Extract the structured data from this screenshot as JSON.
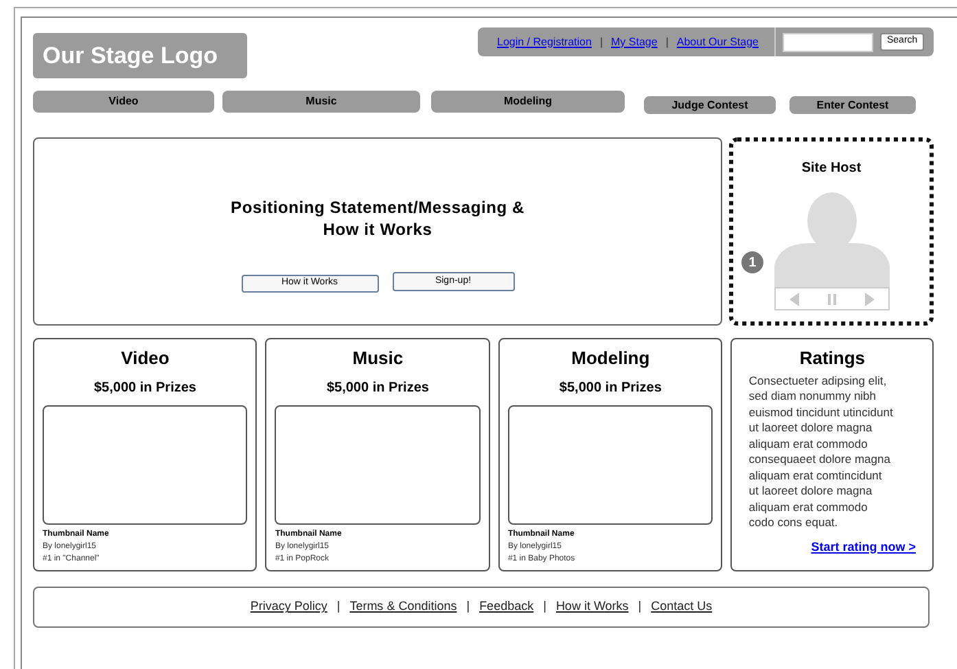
{
  "logo": {
    "text": "Our Stage Logo"
  },
  "top_links": [
    {
      "kind": "link",
      "text": "Login / Registration"
    },
    {
      "kind": "separator",
      "text": "|"
    },
    {
      "kind": "link",
      "text": "My Stage"
    },
    {
      "kind": "separator",
      "text": "|"
    },
    {
      "kind": "link",
      "text": "About Our Stage"
    }
  ],
  "search": {
    "button": "Search"
  },
  "nav": [
    {
      "label": "Video",
      "kind": "tab"
    },
    {
      "label": "Music",
      "kind": "tab"
    },
    {
      "label": "Modeling",
      "kind": "tab"
    },
    {
      "label": "Judge Contest",
      "kind": "action"
    },
    {
      "label": "Enter Contest",
      "kind": "action"
    }
  ],
  "hero": {
    "heading_lines": [
      "Positioning Statement/Messaging &",
      "How it Works"
    ],
    "buttons": [
      "How it Works",
      "Sign-up!"
    ]
  },
  "site_host": {
    "title": "Site Host",
    "badge": "1"
  },
  "categories": [
    {
      "title": "Video",
      "prize": "$5,000 in Prizes",
      "thumb_name": "Thumbnail Name",
      "by": "By lonelygirl15",
      "rank": "#1 in \"Channel\""
    },
    {
      "title": "Music",
      "prize": "$5,000 in Prizes",
      "thumb_name": "Thumbnail Name",
      "by": "By lonelygirl15",
      "rank": "#1 in PopRock"
    },
    {
      "title": "Modeling",
      "prize": "$5,000 in Prizes",
      "thumb_name": "Thumbnail Name",
      "by": "By lonelygirl15",
      "rank": "#1 in Baby Photos"
    }
  ],
  "ratings": {
    "title": "Ratings",
    "lines": [
      "Consectueter adipsing elit,",
      "sed diam nonummy nibh",
      "euismod tincidunt utincidunt",
      "ut laoreet dolore magna",
      "aliquam erat commodo",
      "consequaeet dolore magna",
      "aliquam erat comtincidunt",
      "ut laoreet dolore magna",
      "aliquam erat commodo",
      "codo cons equat."
    ],
    "link": "Start rating now >"
  },
  "footer": [
    {
      "kind": "link",
      "text": "Privacy Policy"
    },
    {
      "kind": "separator",
      "text": "|"
    },
    {
      "kind": "link",
      "text": "Terms & Conditions"
    },
    {
      "kind": "separator",
      "text": "|"
    },
    {
      "kind": "link",
      "text": "Feedback"
    },
    {
      "kind": "separator",
      "text": "|"
    },
    {
      "kind": "link",
      "text": "How it Works"
    },
    {
      "kind": "separator",
      "text": "|"
    },
    {
      "kind": "link",
      "text": "Contact Us"
    }
  ]
}
